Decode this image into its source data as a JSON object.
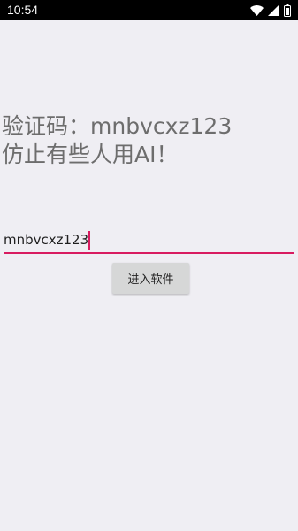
{
  "status_bar": {
    "time": "10:54",
    "icons": [
      "wifi-icon",
      "cellular-signal-icon",
      "battery-icon"
    ]
  },
  "main": {
    "verification_line1": "验证码：mnbvcxz123",
    "verification_line2": "仿止有些人用AI！",
    "code_input": {
      "value": "mnbvcxz123",
      "placeholder": ""
    },
    "enter_button_label": "进入软件"
  },
  "colors": {
    "accent": "#d81b60",
    "background": "#efeef3",
    "status_bar": "#000000",
    "button_bg": "#d6d7d7",
    "text_gray": "#6d6d6d"
  }
}
